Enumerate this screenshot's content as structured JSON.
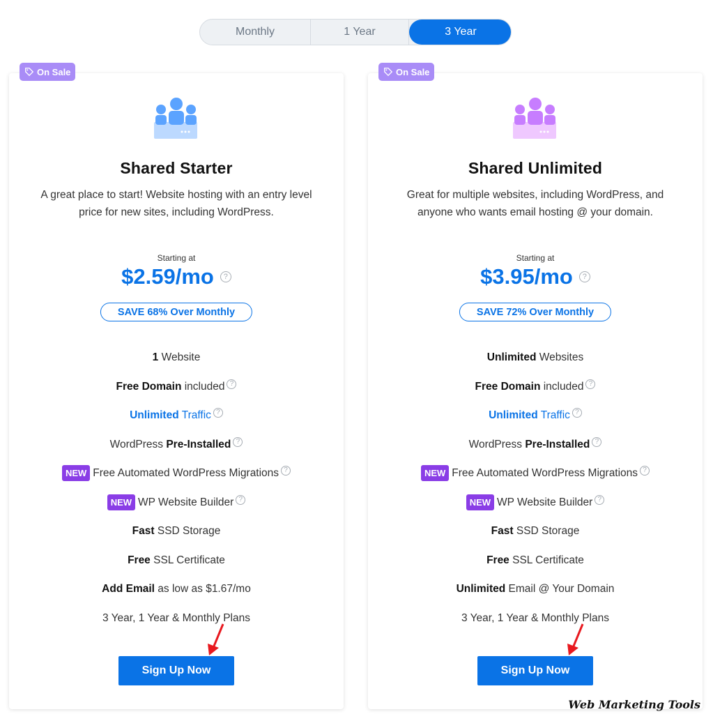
{
  "billing_toggle": {
    "options": [
      "Monthly",
      "1 Year",
      "3 Year"
    ],
    "selected": "3 Year"
  },
  "colors": {
    "accent": "#0a73e6",
    "sale_badge": "#a98cf7",
    "new_badge": "#8a3de6",
    "arrow": "#e8191f"
  },
  "plans": [
    {
      "badge": "On Sale",
      "title": "Shared Starter",
      "desc_line1": "A great place to start! Website hosting with an entry level",
      "desc_line2": "price for new sites, including WordPress.",
      "starting_label": "Starting at",
      "price": "$2.59/mo",
      "save": "SAVE 68% Over Monthly",
      "features": [
        {
          "bold": "1",
          "text": " Website"
        },
        {
          "bold": "Free Domain",
          "text": " included"
        },
        {
          "bold": "Unlimited",
          "text": " Traffic"
        },
        {
          "pre": "WordPress ",
          "bold": "Pre-Installed"
        },
        {
          "new": "NEW",
          "text": "Free Automated WordPress Migrations"
        },
        {
          "new": "NEW",
          "text": "WP Website Builder"
        },
        {
          "bold": "Fast",
          "text": " SSD Storage"
        },
        {
          "bold": "Free",
          "text": " SSL Certificate"
        },
        {
          "bold": "Add Email",
          "text": " as low as $1.67/mo"
        },
        {
          "text": "3 Year, 1 Year & Monthly Plans"
        }
      ],
      "cta": "Sign Up Now",
      "icon": "users-group-icon",
      "icon_color": "#5ba3ff"
    },
    {
      "badge": "On Sale",
      "title": "Shared Unlimited",
      "desc_line1": "Great for multiple websites, including WordPress, and",
      "desc_line2": "anyone who wants email hosting @ your domain.",
      "starting_label": "Starting at",
      "price": "$3.95/mo",
      "save": "SAVE 72% Over Monthly",
      "features": [
        {
          "bold": "Unlimited",
          "text": " Websites"
        },
        {
          "bold": "Free Domain",
          "text": " included"
        },
        {
          "bold": "Unlimited",
          "text": " Traffic"
        },
        {
          "pre": "WordPress ",
          "bold": "Pre-Installed"
        },
        {
          "new": "NEW",
          "text": "Free Automated WordPress Migrations"
        },
        {
          "new": "NEW",
          "text": "WP Website Builder"
        },
        {
          "bold": "Fast",
          "text": " SSD Storage"
        },
        {
          "bold": "Free",
          "text": " SSL Certificate"
        },
        {
          "bold": "Unlimited",
          "text": " Email @ Your Domain"
        },
        {
          "text": "3 Year, 1 Year & Monthly Plans"
        }
      ],
      "cta": "Sign Up Now",
      "icon": "users-group-icon",
      "icon_color": "#c77dff"
    }
  ],
  "watermark": "Web Marketing Tools"
}
